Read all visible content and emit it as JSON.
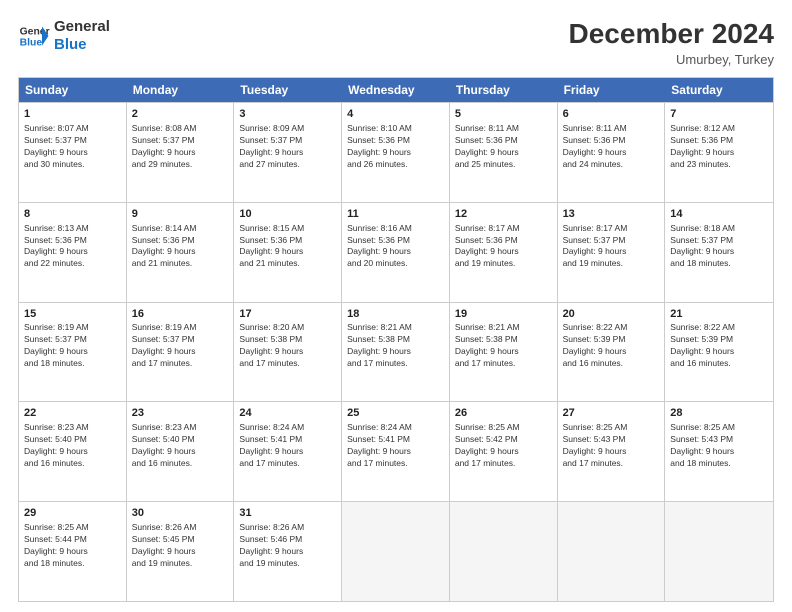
{
  "header": {
    "logo_line1": "General",
    "logo_line2": "Blue",
    "month": "December 2024",
    "location": "Umurbey, Turkey"
  },
  "days_of_week": [
    "Sunday",
    "Monday",
    "Tuesday",
    "Wednesday",
    "Thursday",
    "Friday",
    "Saturday"
  ],
  "weeks": [
    [
      {
        "day": "1",
        "text": "Sunrise: 8:07 AM\nSunset: 5:37 PM\nDaylight: 9 hours\nand 30 minutes."
      },
      {
        "day": "2",
        "text": "Sunrise: 8:08 AM\nSunset: 5:37 PM\nDaylight: 9 hours\nand 29 minutes."
      },
      {
        "day": "3",
        "text": "Sunrise: 8:09 AM\nSunset: 5:37 PM\nDaylight: 9 hours\nand 27 minutes."
      },
      {
        "day": "4",
        "text": "Sunrise: 8:10 AM\nSunset: 5:36 PM\nDaylight: 9 hours\nand 26 minutes."
      },
      {
        "day": "5",
        "text": "Sunrise: 8:11 AM\nSunset: 5:36 PM\nDaylight: 9 hours\nand 25 minutes."
      },
      {
        "day": "6",
        "text": "Sunrise: 8:11 AM\nSunset: 5:36 PM\nDaylight: 9 hours\nand 24 minutes."
      },
      {
        "day": "7",
        "text": "Sunrise: 8:12 AM\nSunset: 5:36 PM\nDaylight: 9 hours\nand 23 minutes."
      }
    ],
    [
      {
        "day": "8",
        "text": "Sunrise: 8:13 AM\nSunset: 5:36 PM\nDaylight: 9 hours\nand 22 minutes."
      },
      {
        "day": "9",
        "text": "Sunrise: 8:14 AM\nSunset: 5:36 PM\nDaylight: 9 hours\nand 21 minutes."
      },
      {
        "day": "10",
        "text": "Sunrise: 8:15 AM\nSunset: 5:36 PM\nDaylight: 9 hours\nand 21 minutes."
      },
      {
        "day": "11",
        "text": "Sunrise: 8:16 AM\nSunset: 5:36 PM\nDaylight: 9 hours\nand 20 minutes."
      },
      {
        "day": "12",
        "text": "Sunrise: 8:17 AM\nSunset: 5:36 PM\nDaylight: 9 hours\nand 19 minutes."
      },
      {
        "day": "13",
        "text": "Sunrise: 8:17 AM\nSunset: 5:37 PM\nDaylight: 9 hours\nand 19 minutes."
      },
      {
        "day": "14",
        "text": "Sunrise: 8:18 AM\nSunset: 5:37 PM\nDaylight: 9 hours\nand 18 minutes."
      }
    ],
    [
      {
        "day": "15",
        "text": "Sunrise: 8:19 AM\nSunset: 5:37 PM\nDaylight: 9 hours\nand 18 minutes."
      },
      {
        "day": "16",
        "text": "Sunrise: 8:19 AM\nSunset: 5:37 PM\nDaylight: 9 hours\nand 17 minutes."
      },
      {
        "day": "17",
        "text": "Sunrise: 8:20 AM\nSunset: 5:38 PM\nDaylight: 9 hours\nand 17 minutes."
      },
      {
        "day": "18",
        "text": "Sunrise: 8:21 AM\nSunset: 5:38 PM\nDaylight: 9 hours\nand 17 minutes."
      },
      {
        "day": "19",
        "text": "Sunrise: 8:21 AM\nSunset: 5:38 PM\nDaylight: 9 hours\nand 17 minutes."
      },
      {
        "day": "20",
        "text": "Sunrise: 8:22 AM\nSunset: 5:39 PM\nDaylight: 9 hours\nand 16 minutes."
      },
      {
        "day": "21",
        "text": "Sunrise: 8:22 AM\nSunset: 5:39 PM\nDaylight: 9 hours\nand 16 minutes."
      }
    ],
    [
      {
        "day": "22",
        "text": "Sunrise: 8:23 AM\nSunset: 5:40 PM\nDaylight: 9 hours\nand 16 minutes."
      },
      {
        "day": "23",
        "text": "Sunrise: 8:23 AM\nSunset: 5:40 PM\nDaylight: 9 hours\nand 16 minutes."
      },
      {
        "day": "24",
        "text": "Sunrise: 8:24 AM\nSunset: 5:41 PM\nDaylight: 9 hours\nand 17 minutes."
      },
      {
        "day": "25",
        "text": "Sunrise: 8:24 AM\nSunset: 5:41 PM\nDaylight: 9 hours\nand 17 minutes."
      },
      {
        "day": "26",
        "text": "Sunrise: 8:25 AM\nSunset: 5:42 PM\nDaylight: 9 hours\nand 17 minutes."
      },
      {
        "day": "27",
        "text": "Sunrise: 8:25 AM\nSunset: 5:43 PM\nDaylight: 9 hours\nand 17 minutes."
      },
      {
        "day": "28",
        "text": "Sunrise: 8:25 AM\nSunset: 5:43 PM\nDaylight: 9 hours\nand 18 minutes."
      }
    ],
    [
      {
        "day": "29",
        "text": "Sunrise: 8:25 AM\nSunset: 5:44 PM\nDaylight: 9 hours\nand 18 minutes."
      },
      {
        "day": "30",
        "text": "Sunrise: 8:26 AM\nSunset: 5:45 PM\nDaylight: 9 hours\nand 19 minutes."
      },
      {
        "day": "31",
        "text": "Sunrise: 8:26 AM\nSunset: 5:46 PM\nDaylight: 9 hours\nand 19 minutes."
      },
      {
        "day": "",
        "text": ""
      },
      {
        "day": "",
        "text": ""
      },
      {
        "day": "",
        "text": ""
      },
      {
        "day": "",
        "text": ""
      }
    ]
  ]
}
